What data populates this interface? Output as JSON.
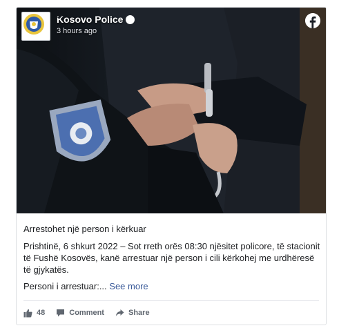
{
  "post": {
    "author": "Kosovo Police",
    "time": "3 hours ago",
    "headline": "Arrestohet një person i kërkuar",
    "body": "Prishtinë, 6 shkurt 2022 – Sot rreth orës 08:30 njësitet policore, të stacionit të Fushë Kosovës, kanë arrestuar një person i cili kërkohej me urdhëresë të gjykatës.",
    "preview": "Personi i arrestuar:...",
    "see_more": "See more"
  },
  "actions": {
    "like_count": "48",
    "comment_label": "Comment",
    "share_label": "Share"
  },
  "colors": {
    "link": "#385898",
    "muted": "#606770",
    "border": "#dddfe2"
  },
  "icons": [
    "kosovo-police-badge-icon",
    "verified-icon",
    "facebook-icon",
    "like-icon",
    "comment-icon",
    "share-icon"
  ]
}
